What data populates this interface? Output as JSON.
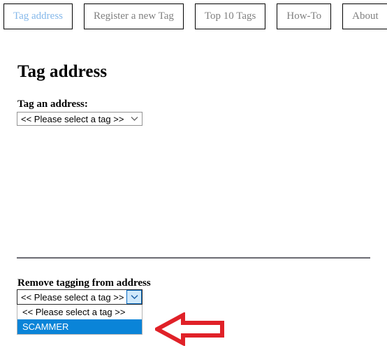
{
  "nav": {
    "tabs": [
      {
        "label": "Tag address",
        "active": true
      },
      {
        "label": "Register a new Tag",
        "active": false
      },
      {
        "label": "Top 10 Tags",
        "active": false
      },
      {
        "label": "How-To",
        "active": false
      },
      {
        "label": "About",
        "active": false
      }
    ],
    "active_color": "#85b8ea",
    "inactive_color": "#808080"
  },
  "main": {
    "page_title": "Tag address",
    "tag_section": {
      "label": "Tag an address:",
      "select": {
        "value": "<< Please select a tag >>",
        "chevron": "chevron-down-icon",
        "options": [
          "<< Please select a tag >>"
        ]
      }
    },
    "remove_section": {
      "label": "Remove tagging from address",
      "select": {
        "value": "<< Please select a tag >>",
        "chevron": "chevron-down-icon",
        "expanded": true,
        "options": [
          {
            "label": "<< Please select a tag >>",
            "selected": false
          },
          {
            "label": "SCAMMER",
            "selected": true
          }
        ],
        "highlight_color": "#0a84d8"
      }
    }
  },
  "annotation": {
    "arrow": {
      "name": "red-left-arrow-annotation",
      "color": "#e02128",
      "direction": "left"
    }
  }
}
